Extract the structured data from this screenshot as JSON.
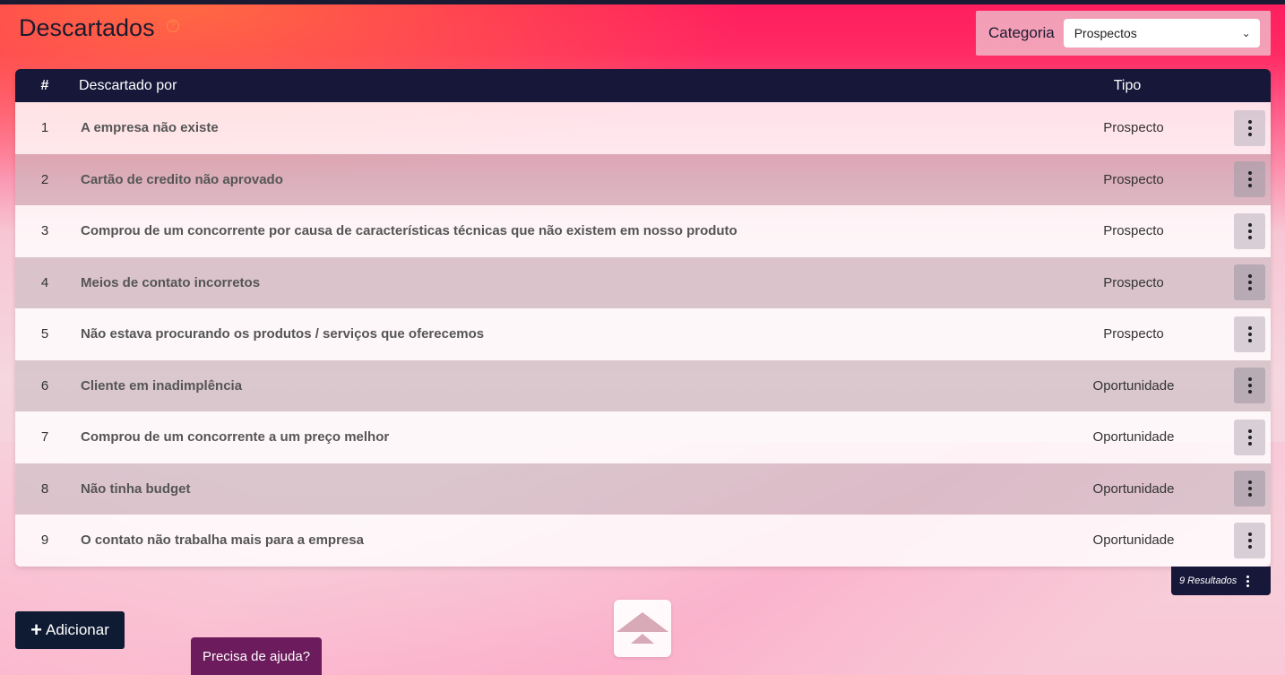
{
  "page": {
    "title": "Descartados",
    "help_icon": "question-circle-icon"
  },
  "filter": {
    "label": "Categoria",
    "selected": "Prospectos"
  },
  "table": {
    "columns": {
      "num": "#",
      "by": "Descartado por",
      "tipo": "Tipo"
    },
    "rows": [
      {
        "num": "1",
        "by": "A empresa não existe",
        "tipo": "Prospecto"
      },
      {
        "num": "2",
        "by": "Cartão de credito não aprovado",
        "tipo": "Prospecto"
      },
      {
        "num": "3",
        "by": "Comprou de um concorrente por causa de características técnicas que não existem em nosso produto",
        "tipo": "Prospecto"
      },
      {
        "num": "4",
        "by": "Meios de contato incorretos",
        "tipo": "Prospecto"
      },
      {
        "num": "5",
        "by": "Não estava procurando os produtos / serviços que oferecemos",
        "tipo": "Prospecto"
      },
      {
        "num": "6",
        "by": "Cliente em inadimplência",
        "tipo": "Oportunidade"
      },
      {
        "num": "7",
        "by": "Comprou de um concorrente a um preço melhor",
        "tipo": "Oportunidade"
      },
      {
        "num": "8",
        "by": "Não tinha budget",
        "tipo": "Oportunidade"
      },
      {
        "num": "9",
        "by": "O contato não trabalha mais para a empresa",
        "tipo": "Oportunidade"
      }
    ]
  },
  "footer": {
    "results": "9 Resultados",
    "add_label": "Adicionar",
    "help_label": "Precisa de ajuda?"
  },
  "colors": {
    "header": "#17173a",
    "accent": "#ff1d5e",
    "help_button": "#6c1b5c"
  }
}
